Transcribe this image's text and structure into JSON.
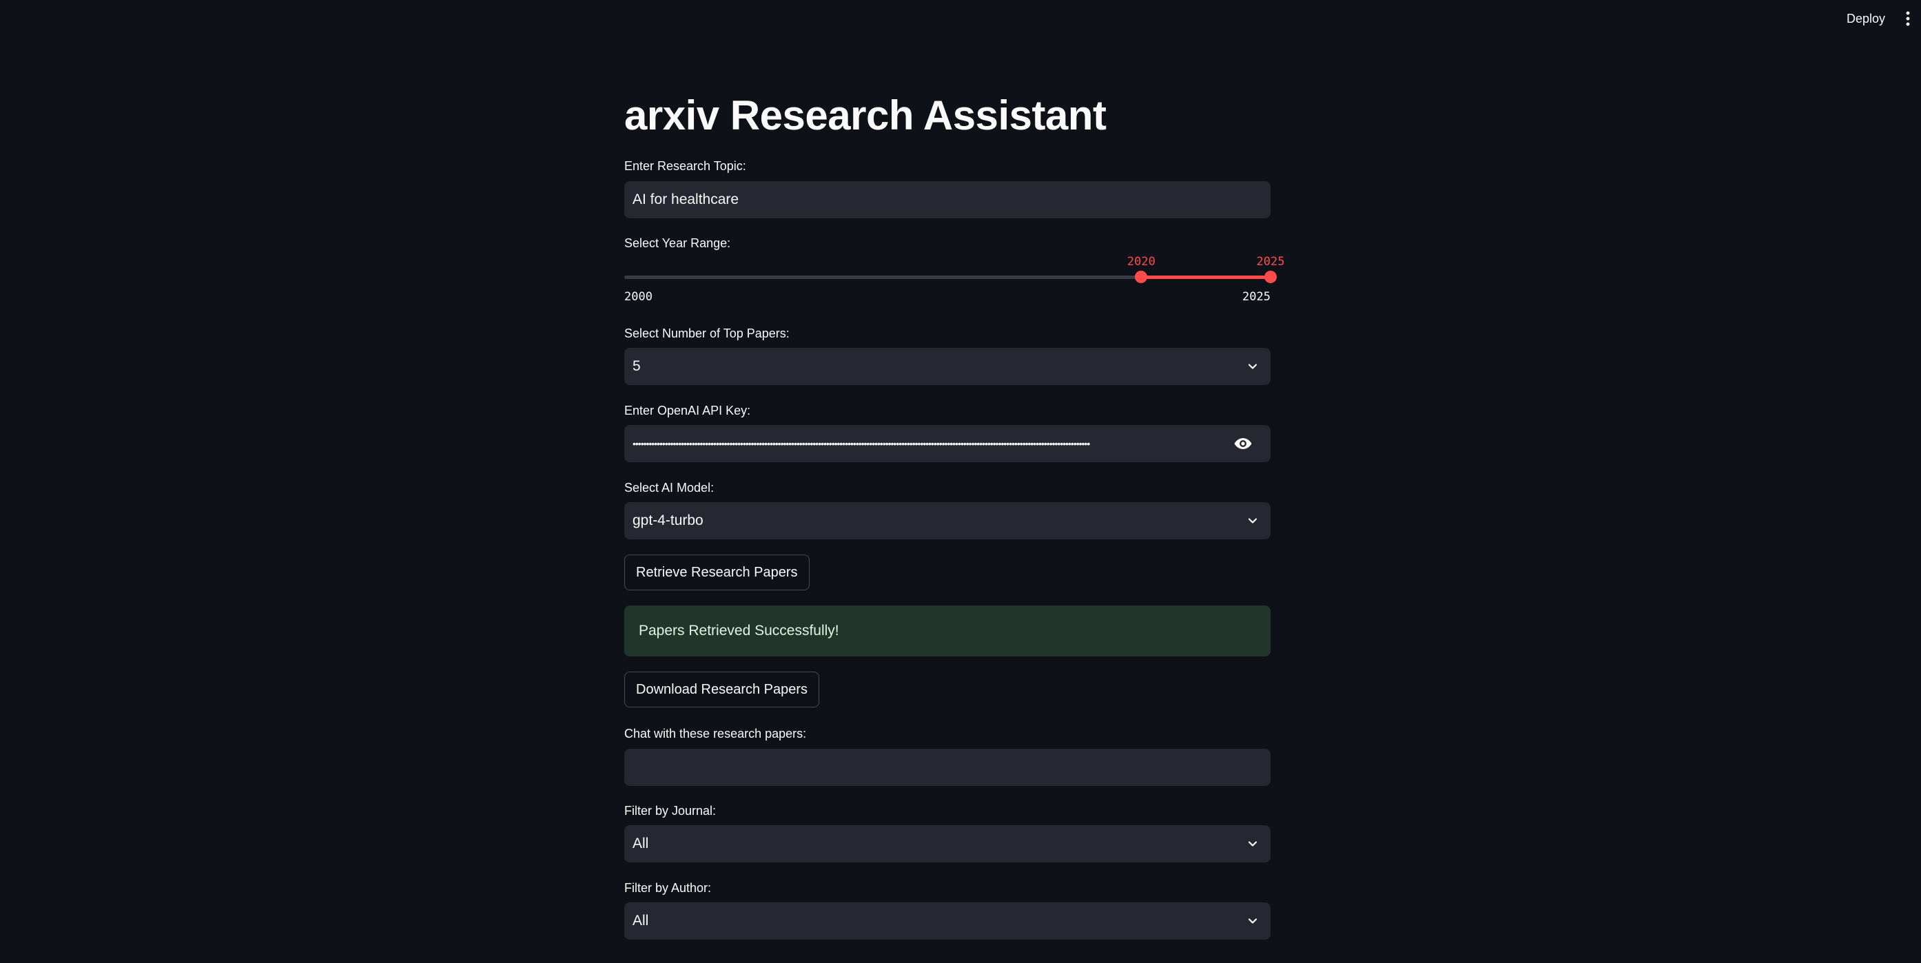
{
  "header": {
    "deploy_label": "Deploy",
    "menu_icon": "more-vertical-icon"
  },
  "page": {
    "title": "arxiv Research Assistant"
  },
  "topic": {
    "label": "Enter Research Topic:",
    "value": "AI for healthcare"
  },
  "year_range": {
    "label": "Select Year Range:",
    "min": 2000,
    "max": 2025,
    "selected_low": "2020",
    "selected_high": "2025",
    "min_label": "2000",
    "max_label": "2025",
    "accent_color": "#ff4b4b"
  },
  "top_papers": {
    "label": "Select Number of Top Papers:",
    "value": "5"
  },
  "api_key": {
    "label": "Enter OpenAI API Key:",
    "masked_value": "••••••••••••••••••••••••••••••••••••••••••••••••••••••••••••••••••••••••••••••••••••••••••••••••••••••••••••••••••••••••••••••••••••••••••••••••••••••••••••••••••••••••••",
    "icon": "eye-icon"
  },
  "model": {
    "label": "Select AI Model:",
    "value": "gpt-4-turbo"
  },
  "retrieve_button": {
    "label": "Retrieve Research Papers"
  },
  "success_alert": {
    "text": "Papers Retrieved Successfully!",
    "color": "#21362a"
  },
  "download_button": {
    "label": "Download Research Papers"
  },
  "chat": {
    "label": "Chat with these research papers:",
    "value": ""
  },
  "journal_filter": {
    "label": "Filter by Journal:",
    "value": "All"
  },
  "author_filter": {
    "label": "Filter by Author:",
    "value": "All"
  }
}
